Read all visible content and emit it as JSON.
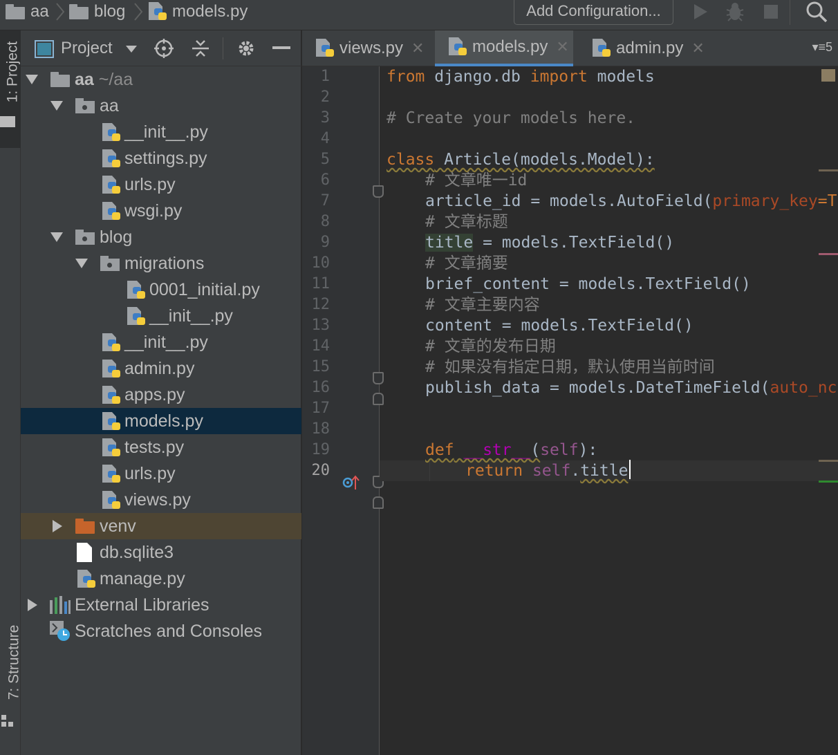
{
  "breadcrumb": {
    "items": [
      {
        "label": "aa"
      },
      {
        "label": "blog"
      },
      {
        "label": "models.py"
      }
    ]
  },
  "toolbar": {
    "run_config_label": "Add Configuration...",
    "icons": [
      "run-icon",
      "debug-icon",
      "stop-icon",
      "search-icon"
    ]
  },
  "left_stripe": {
    "project_label": "1: Project",
    "structure_label": "7: Structure"
  },
  "project_panel": {
    "title": "Project",
    "tree": [
      {
        "label": "aa",
        "hint": "~/aa",
        "type": "root-folder",
        "expanded": true
      },
      {
        "label": "aa",
        "type": "package",
        "expanded": true
      },
      {
        "label": "__init__.py",
        "type": "py"
      },
      {
        "label": "settings.py",
        "type": "py"
      },
      {
        "label": "urls.py",
        "type": "py"
      },
      {
        "label": "wsgi.py",
        "type": "py"
      },
      {
        "label": "blog",
        "type": "package",
        "expanded": true
      },
      {
        "label": "migrations",
        "type": "package",
        "expanded": true
      },
      {
        "label": "0001_initial.py",
        "type": "py"
      },
      {
        "label": "__init__.py",
        "type": "py"
      },
      {
        "label": "__init__.py",
        "type": "py"
      },
      {
        "label": "admin.py",
        "type": "py"
      },
      {
        "label": "apps.py",
        "type": "py"
      },
      {
        "label": "models.py",
        "type": "py",
        "selected": true
      },
      {
        "label": "tests.py",
        "type": "py"
      },
      {
        "label": "urls.py",
        "type": "py"
      },
      {
        "label": "views.py",
        "type": "py"
      },
      {
        "label": "venv",
        "type": "excluded-folder",
        "expanded": false
      },
      {
        "label": "db.sqlite3",
        "type": "file"
      },
      {
        "label": "manage.py",
        "type": "py"
      },
      {
        "label": "External Libraries",
        "type": "libraries",
        "expanded": false
      },
      {
        "label": "Scratches and Consoles",
        "type": "scratches"
      }
    ]
  },
  "editor": {
    "tabs": [
      {
        "label": "views.py",
        "active": false
      },
      {
        "label": "models.py",
        "active": true
      },
      {
        "label": "admin.py",
        "active": false
      }
    ],
    "tab_overflow": "5",
    "current_line": 20,
    "line_numbers": [
      "1",
      "2",
      "3",
      "4",
      "5",
      "6",
      "7",
      "8",
      "9",
      "10",
      "11",
      "12",
      "13",
      "14",
      "15",
      "16",
      "17",
      "18",
      "19",
      "20"
    ],
    "code": {
      "l1_from": "from",
      "l1_mod": " django.db ",
      "l1_import": "import",
      "l1_rest": " models",
      "l3": "# Create your models here.",
      "l5_class": "class",
      "l5_rest": " Article(models.Model):",
      "l6": "# 文章唯一id",
      "l7_a": "article_id = models.AutoField(",
      "l7_b": "primary_key",
      "l7_c": "=T",
      "l8": "# 文章标题",
      "l9_a": "title",
      "l9_b": " = models.TextField()",
      "l10": "# 文章摘要",
      "l11": "brief_content = models.TextField()",
      "l12": "# 文章主要内容",
      "l13": "content = models.TextField()",
      "l14": "# 文章的发布日期",
      "l15": "# 如果没有指定日期，默认使用当前时间",
      "l16_a": "publish_data = models.DateTimeField(",
      "l16_b": "auto_nc",
      "l19_def": "def",
      "l19_dunder": " __str__",
      "l19_p1": "(",
      "l19_self": "self",
      "l19_p2": "):",
      "l20_ret": "return",
      "l20_self": " self",
      "l20_dot": ".",
      "l20_title": "title"
    }
  },
  "colors": {
    "keyword": "#cc7832",
    "comment": "#808080",
    "argument": "#aa4926",
    "dunder": "#b200b2",
    "self": "#94558d",
    "selection": "#0d293e",
    "active_tab_underline": "#4a88c7"
  }
}
